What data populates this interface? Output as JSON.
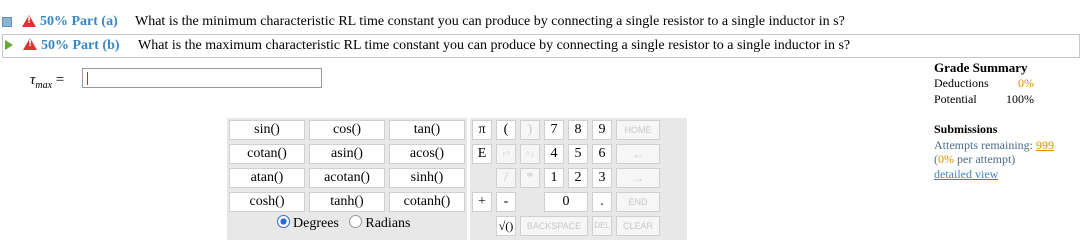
{
  "parts": [
    {
      "label": "50% Part (a)",
      "question": "What is the minimum characteristic RL time constant you can produce by connecting a single resistor to a single inductor in s?"
    },
    {
      "label": "50% Part (b)",
      "question": "What is the maximum characteristic RL time constant you can produce by connecting a single resistor to a single inductor in s?"
    }
  ],
  "answer": {
    "symbol": "τ",
    "subscript": "max",
    "equals": "=",
    "value": ""
  },
  "functions": [
    "sin()",
    "cos()",
    "tan()",
    "cotan()",
    "asin()",
    "acos()",
    "atan()",
    "acotan()",
    "sinh()",
    "cosh()",
    "tanh()",
    "cotanh()"
  ],
  "angle_mode": {
    "degrees": "Degrees",
    "radians": "Radians",
    "selected": "Degrees"
  },
  "keypad": {
    "pi": "π",
    "lparen": "(",
    "rparen": ")",
    "e": "E",
    "up": "↑^",
    "up2": "^↓",
    "slash": "/",
    "star": "*",
    "plus": "+",
    "minus": "-",
    "sqrt": "√()",
    "d7": "7",
    "d8": "8",
    "d9": "9",
    "d4": "4",
    "d5": "5",
    "d6": "6",
    "d1": "1",
    "d2": "2",
    "d3": "3",
    "d0": "0",
    "dot": ".",
    "home": "HOME",
    "back_arrow": "←",
    "fwd_arrow": "→",
    "end": "END",
    "backspace": "BACKSPACE",
    "del": "DEL",
    "clear": "CLEAR"
  },
  "grade_summary": {
    "title": "Grade Summary",
    "deductions_label": "Deductions",
    "deductions_value": "0%",
    "potential_label": "Potential",
    "potential_value": "100%"
  },
  "submissions": {
    "title": "Submissions",
    "attempts_label": "Attempts remaining:",
    "attempts_value": "999",
    "per_attempt_prefix": "(",
    "per_attempt_value": "0%",
    "per_attempt_suffix": " per attempt)",
    "detailed_view": "detailed view"
  },
  "colors": {
    "part_label": "#3a86c5",
    "warning": "#dd3333",
    "orange": "#e38b00"
  }
}
